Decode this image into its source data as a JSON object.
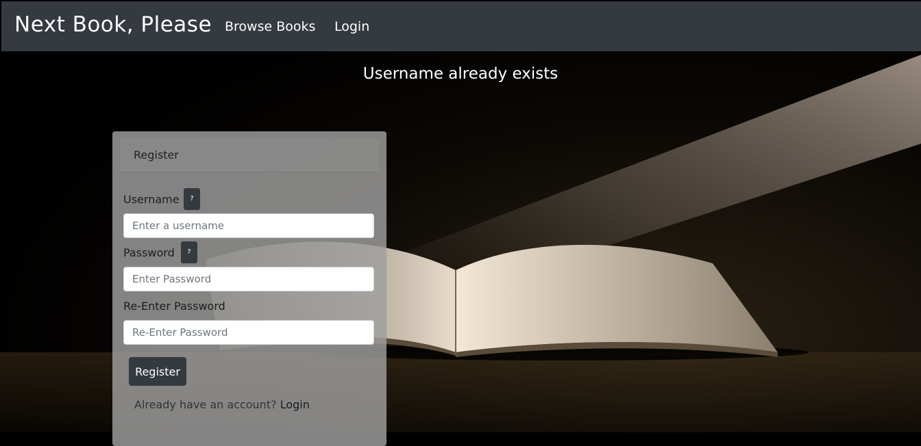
{
  "navbar": {
    "brand": "Next Book, Please",
    "browse_label": "Browse Books",
    "login_label": "Login"
  },
  "flash_message": "Username already exists",
  "form": {
    "header": "Register",
    "username_label": "Username",
    "username_placeholder": "Enter a username",
    "password_label": "Password",
    "password_placeholder": "Enter Password",
    "reenter_label": "Re-Enter Password",
    "reenter_placeholder": "Re-Enter Password",
    "help_glyph": "?",
    "submit_label": "Register",
    "footer_text": "Already have an account?",
    "footer_link": "Login"
  },
  "colors": {
    "navbar": "#343a40",
    "button": "#343a40",
    "card": "#a0a0a0"
  }
}
